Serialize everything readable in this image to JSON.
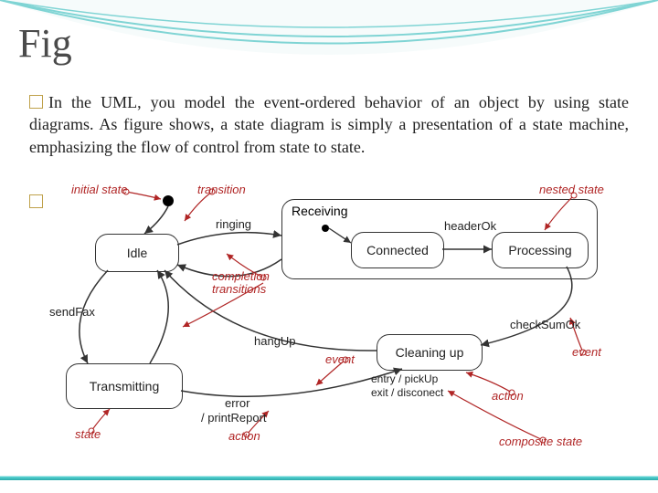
{
  "title": "Fig",
  "paragraph": "In the UML, you model the event-ordered behavior of an object by using state diagrams. As figure shows, a state diagram is simply a presentation of a state machine, emphasizing the flow of control from state to state.",
  "diagram": {
    "composite": {
      "label": "Receiving"
    },
    "states": {
      "idle": "Idle",
      "connected": "Connected",
      "processing": "Processing",
      "transmitting": "Transmitting",
      "cleaning": "Cleaning up"
    },
    "edge_labels": {
      "ringing": "ringing",
      "headerOk": "headerOk",
      "sendFax": "sendFax",
      "hangUp": "hangUp",
      "checkSumOk": "checkSumOk",
      "error": "error",
      "printReport": "/ printReport",
      "entry": "entry / pickUp",
      "exit": "exit / disconect"
    },
    "callouts": {
      "initial_state": "initial state",
      "transition": "transition",
      "nested_state": "nested state",
      "completion1": "completion",
      "completion2": "transitions",
      "event": "event",
      "action": "action",
      "state": "state",
      "composite_state": "composite state"
    },
    "transitions": [
      {
        "from": "initial",
        "to": "Idle",
        "label": ""
      },
      {
        "from": "Idle",
        "to": "Receiving",
        "label": "ringing"
      },
      {
        "from": "Receiving.initial",
        "to": "Connected",
        "label": ""
      },
      {
        "from": "Connected",
        "to": "Processing",
        "label": "headerOk"
      },
      {
        "from": "Processing",
        "to": "Cleaning up",
        "label": "checkSumOk"
      },
      {
        "from": "Idle",
        "to": "Transmitting",
        "label": "sendFax"
      },
      {
        "from": "Transmitting",
        "to": "Idle",
        "label": "(completion)"
      },
      {
        "from": "Receiving",
        "to": "Idle",
        "label": "(completion)"
      },
      {
        "from": "Cleaning up",
        "to": "Idle",
        "label": "hangUp"
      },
      {
        "from": "Transmitting",
        "to": "Cleaning up",
        "label": "error / printReport"
      }
    ],
    "state_actions": {
      "Cleaning up": {
        "entry": "pickUp",
        "exit": "disconect"
      }
    }
  }
}
